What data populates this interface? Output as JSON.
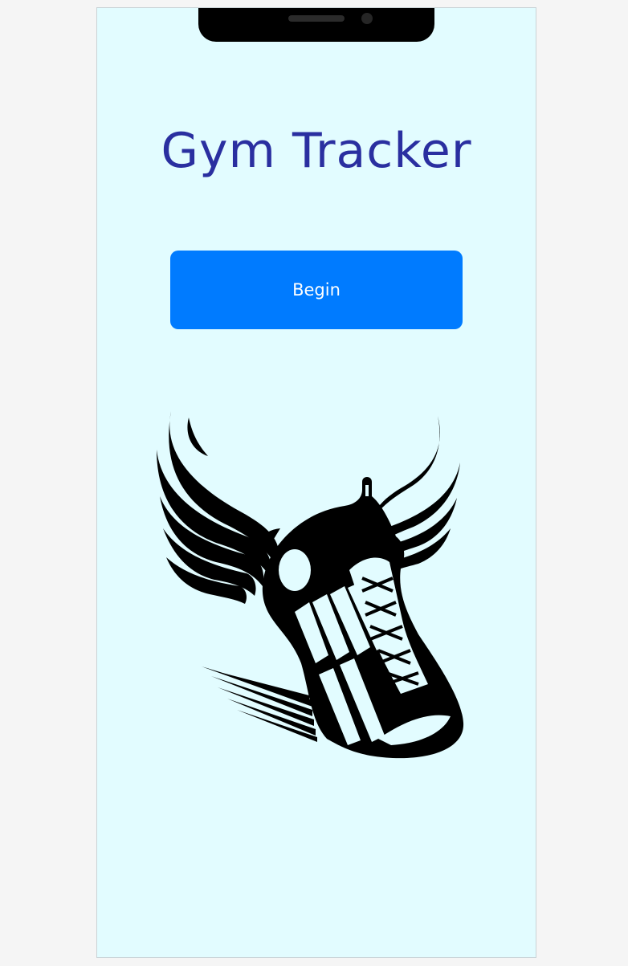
{
  "app": {
    "title": "Gym Tracker"
  },
  "actions": {
    "begin_label": "Begin"
  },
  "colors": {
    "background": "#e2fcff",
    "title": "#2a2fa0",
    "button": "#007bff",
    "button_text": "#ffffff",
    "logo": "#000000"
  },
  "logo": {
    "icon": "winged-running-shoe-icon"
  }
}
